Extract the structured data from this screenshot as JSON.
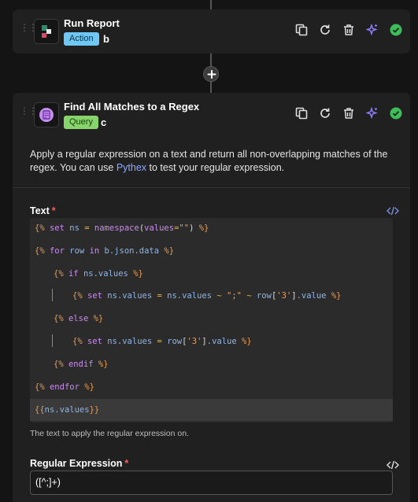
{
  "colors": {
    "keyword": "#c98cf0",
    "delimiter": "#e69b55",
    "operator": "#e0b35a",
    "string": "#e0a06a",
    "variable": "#8fb5e8",
    "plain": "#d8d8d8",
    "check": "#3ebd5a",
    "sparkle": "#8a7cf5"
  },
  "steps": [
    {
      "title": "Run Report",
      "badge": "Action",
      "letter": "b",
      "icon": "report-app-icon"
    },
    {
      "title": "Find All Matches to a Regex",
      "badge": "Query",
      "letter": "c",
      "icon": "regex-app-icon",
      "description_before": "Apply a regular expression on a text and return all non-overlapping matches of the regex. You can use ",
      "description_link": "Pythex",
      "description_after": " to test your regular expression.",
      "fields": {
        "text": {
          "label": "Text",
          "required_mark": "*",
          "helper": "The text to apply the regular expression on.",
          "code_lines": [
            [
              [
                "{%",
                "delim"
              ],
              [
                " ",
                "plain"
              ],
              [
                "set",
                "kw"
              ],
              [
                " ns ",
                "var"
              ],
              [
                "=",
                "op"
              ],
              [
                " ",
                "plain"
              ],
              [
                "namespace",
                "kw"
              ],
              [
                "(",
                "plain"
              ],
              [
                "values",
                "kw"
              ],
              [
                "=",
                "op"
              ],
              [
                "\"\"",
                "str"
              ],
              [
                ")",
                "plain"
              ],
              [
                " ",
                "plain"
              ],
              [
                "%}",
                "delim"
              ]
            ],
            [
              [
                "{%",
                "delim"
              ],
              [
                " ",
                "plain"
              ],
              [
                "for",
                "kw"
              ],
              [
                " row ",
                "var"
              ],
              [
                "in",
                "kw"
              ],
              [
                " b.json.data ",
                "var"
              ],
              [
                "%}",
                "delim"
              ]
            ],
            [
              [
                "{%",
                "delim"
              ],
              [
                " ",
                "plain"
              ],
              [
                "if",
                "kw"
              ],
              [
                " ns.values ",
                "var"
              ],
              [
                "%}",
                "delim"
              ]
            ],
            [
              [
                "{%",
                "delim"
              ],
              [
                " ",
                "plain"
              ],
              [
                "set",
                "kw"
              ],
              [
                " ns.values ",
                "var"
              ],
              [
                "=",
                "op"
              ],
              [
                " ns.values ",
                "var"
              ],
              [
                "~",
                "op"
              ],
              [
                " ",
                "plain"
              ],
              [
                "\";\"",
                "str"
              ],
              [
                " ",
                "plain"
              ],
              [
                "~",
                "op"
              ],
              [
                " row",
                "var"
              ],
              [
                "[",
                "plain"
              ],
              [
                "'3'",
                "str"
              ],
              [
                "]",
                "plain"
              ],
              [
                ".value ",
                "var"
              ],
              [
                "%}",
                "delim"
              ]
            ],
            [
              [
                "{%",
                "delim"
              ],
              [
                " ",
                "plain"
              ],
              [
                "else",
                "kw"
              ],
              [
                " ",
                "plain"
              ],
              [
                "%}",
                "delim"
              ]
            ],
            [
              [
                "{%",
                "delim"
              ],
              [
                " ",
                "plain"
              ],
              [
                "set",
                "kw"
              ],
              [
                " ns.values ",
                "var"
              ],
              [
                "=",
                "op"
              ],
              [
                " row",
                "var"
              ],
              [
                "[",
                "plain"
              ],
              [
                "'3'",
                "str"
              ],
              [
                "]",
                "plain"
              ],
              [
                ".value ",
                "var"
              ],
              [
                "%}",
                "delim"
              ]
            ],
            [
              [
                "{%",
                "delim"
              ],
              [
                " ",
                "plain"
              ],
              [
                "endif",
                "kw"
              ],
              [
                " ",
                "plain"
              ],
              [
                "%}",
                "delim"
              ]
            ],
            [
              [
                "{%",
                "delim"
              ],
              [
                " ",
                "plain"
              ],
              [
                "endfor",
                "kw"
              ],
              [
                " ",
                "plain"
              ],
              [
                "%}",
                "delim"
              ]
            ],
            [
              [
                "{{",
                "delim"
              ],
              [
                "ns.values",
                "var"
              ],
              [
                "}}",
                "delim"
              ]
            ]
          ]
        },
        "regex": {
          "label": "Regular Expression",
          "required_mark": "*",
          "value": "([^;]+)"
        }
      }
    }
  ],
  "action_icons": [
    "duplicate-icon",
    "refresh-icon",
    "trash-icon",
    "sparkle-icon",
    "check-circle-icon"
  ],
  "code_toggle_glyph": "</>"
}
